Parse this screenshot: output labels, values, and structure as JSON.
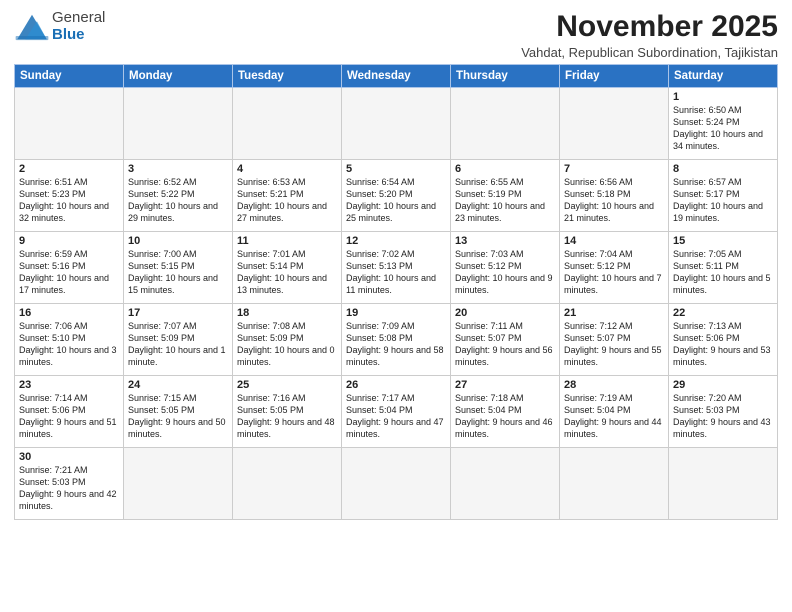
{
  "logo": {
    "line1": "General",
    "line2": "Blue"
  },
  "header": {
    "month_year": "November 2025",
    "subtitle": "Vahdat, Republican Subordination, Tajikistan"
  },
  "weekdays": [
    "Sunday",
    "Monday",
    "Tuesday",
    "Wednesday",
    "Thursday",
    "Friday",
    "Saturday"
  ],
  "weeks": [
    [
      {
        "day": "",
        "info": ""
      },
      {
        "day": "",
        "info": ""
      },
      {
        "day": "",
        "info": ""
      },
      {
        "day": "",
        "info": ""
      },
      {
        "day": "",
        "info": ""
      },
      {
        "day": "",
        "info": ""
      },
      {
        "day": "1",
        "info": "Sunrise: 6:50 AM\nSunset: 5:24 PM\nDaylight: 10 hours\nand 34 minutes."
      }
    ],
    [
      {
        "day": "2",
        "info": "Sunrise: 6:51 AM\nSunset: 5:23 PM\nDaylight: 10 hours\nand 32 minutes."
      },
      {
        "day": "3",
        "info": "Sunrise: 6:52 AM\nSunset: 5:22 PM\nDaylight: 10 hours\nand 29 minutes."
      },
      {
        "day": "4",
        "info": "Sunrise: 6:53 AM\nSunset: 5:21 PM\nDaylight: 10 hours\nand 27 minutes."
      },
      {
        "day": "5",
        "info": "Sunrise: 6:54 AM\nSunset: 5:20 PM\nDaylight: 10 hours\nand 25 minutes."
      },
      {
        "day": "6",
        "info": "Sunrise: 6:55 AM\nSunset: 5:19 PM\nDaylight: 10 hours\nand 23 minutes."
      },
      {
        "day": "7",
        "info": "Sunrise: 6:56 AM\nSunset: 5:18 PM\nDaylight: 10 hours\nand 21 minutes."
      },
      {
        "day": "8",
        "info": "Sunrise: 6:57 AM\nSunset: 5:17 PM\nDaylight: 10 hours\nand 19 minutes."
      }
    ],
    [
      {
        "day": "9",
        "info": "Sunrise: 6:59 AM\nSunset: 5:16 PM\nDaylight: 10 hours\nand 17 minutes."
      },
      {
        "day": "10",
        "info": "Sunrise: 7:00 AM\nSunset: 5:15 PM\nDaylight: 10 hours\nand 15 minutes."
      },
      {
        "day": "11",
        "info": "Sunrise: 7:01 AM\nSunset: 5:14 PM\nDaylight: 10 hours\nand 13 minutes."
      },
      {
        "day": "12",
        "info": "Sunrise: 7:02 AM\nSunset: 5:13 PM\nDaylight: 10 hours\nand 11 minutes."
      },
      {
        "day": "13",
        "info": "Sunrise: 7:03 AM\nSunset: 5:12 PM\nDaylight: 10 hours\nand 9 minutes."
      },
      {
        "day": "14",
        "info": "Sunrise: 7:04 AM\nSunset: 5:12 PM\nDaylight: 10 hours\nand 7 minutes."
      },
      {
        "day": "15",
        "info": "Sunrise: 7:05 AM\nSunset: 5:11 PM\nDaylight: 10 hours\nand 5 minutes."
      }
    ],
    [
      {
        "day": "16",
        "info": "Sunrise: 7:06 AM\nSunset: 5:10 PM\nDaylight: 10 hours\nand 3 minutes."
      },
      {
        "day": "17",
        "info": "Sunrise: 7:07 AM\nSunset: 5:09 PM\nDaylight: 10 hours\nand 1 minute."
      },
      {
        "day": "18",
        "info": "Sunrise: 7:08 AM\nSunset: 5:09 PM\nDaylight: 10 hours\nand 0 minutes."
      },
      {
        "day": "19",
        "info": "Sunrise: 7:09 AM\nSunset: 5:08 PM\nDaylight: 9 hours\nand 58 minutes."
      },
      {
        "day": "20",
        "info": "Sunrise: 7:11 AM\nSunset: 5:07 PM\nDaylight: 9 hours\nand 56 minutes."
      },
      {
        "day": "21",
        "info": "Sunrise: 7:12 AM\nSunset: 5:07 PM\nDaylight: 9 hours\nand 55 minutes."
      },
      {
        "day": "22",
        "info": "Sunrise: 7:13 AM\nSunset: 5:06 PM\nDaylight: 9 hours\nand 53 minutes."
      }
    ],
    [
      {
        "day": "23",
        "info": "Sunrise: 7:14 AM\nSunset: 5:06 PM\nDaylight: 9 hours\nand 51 minutes."
      },
      {
        "day": "24",
        "info": "Sunrise: 7:15 AM\nSunset: 5:05 PM\nDaylight: 9 hours\nand 50 minutes."
      },
      {
        "day": "25",
        "info": "Sunrise: 7:16 AM\nSunset: 5:05 PM\nDaylight: 9 hours\nand 48 minutes."
      },
      {
        "day": "26",
        "info": "Sunrise: 7:17 AM\nSunset: 5:04 PM\nDaylight: 9 hours\nand 47 minutes."
      },
      {
        "day": "27",
        "info": "Sunrise: 7:18 AM\nSunset: 5:04 PM\nDaylight: 9 hours\nand 46 minutes."
      },
      {
        "day": "28",
        "info": "Sunrise: 7:19 AM\nSunset: 5:04 PM\nDaylight: 9 hours\nand 44 minutes."
      },
      {
        "day": "29",
        "info": "Sunrise: 7:20 AM\nSunset: 5:03 PM\nDaylight: 9 hours\nand 43 minutes."
      }
    ],
    [
      {
        "day": "30",
        "info": "Sunrise: 7:21 AM\nSunset: 5:03 PM\nDaylight: 9 hours\nand 42 minutes."
      },
      {
        "day": "",
        "info": ""
      },
      {
        "day": "",
        "info": ""
      },
      {
        "day": "",
        "info": ""
      },
      {
        "day": "",
        "info": ""
      },
      {
        "day": "",
        "info": ""
      },
      {
        "day": "",
        "info": ""
      }
    ]
  ]
}
